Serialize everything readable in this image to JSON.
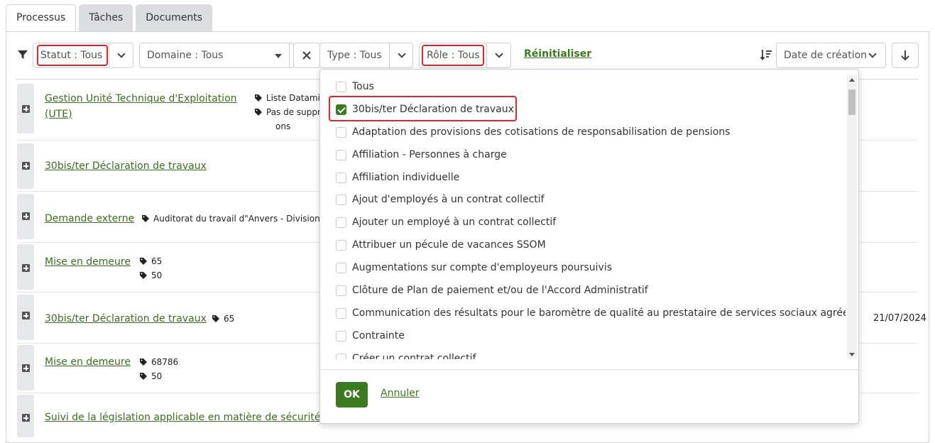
{
  "tabs": [
    {
      "label": "Processus"
    },
    {
      "label": "Tâches"
    },
    {
      "label": "Documents"
    }
  ],
  "filters": {
    "statut": "Statut : Tous",
    "domaine": "Domaine : Tous",
    "type": "Type : Tous",
    "role": "Rôle : Tous",
    "reset": "Réinitialiser",
    "sort": "Date de création"
  },
  "rows": [
    {
      "title_l1": "Gestion Unité Technique d'Exploitation",
      "title_l2": "(UTE)",
      "tag1": "Liste Datamin",
      "tag2": "Pas de suppr",
      "tag2b": "ons"
    },
    {
      "title": "30bis/ter Déclaration de travaux"
    },
    {
      "title": "Demande externe",
      "tag1": "Auditorat du travail d\"Anvers - Division"
    },
    {
      "title": "Mise en demeure",
      "tag1": "65",
      "tag2": "50"
    },
    {
      "title": "30bis/ter Déclaration de travaux",
      "tag1": "65",
      "date": "21/07/2024"
    },
    {
      "title": "Mise en demeure",
      "tag1": "68786",
      "tag2": "50"
    },
    {
      "title": "Suivi de la législation applicable en matière de sécurité s"
    }
  ],
  "dropdown": {
    "options": [
      {
        "label": "Tous",
        "checked": false
      },
      {
        "label": "30bis/ter Déclaration de travaux",
        "checked": true
      },
      {
        "label": "Adaptation des provisions des cotisations de responsabilisation de pensions",
        "checked": false
      },
      {
        "label": "Affiliation - Personnes à charge",
        "checked": false
      },
      {
        "label": "Affiliation individuelle",
        "checked": false
      },
      {
        "label": "Ajout d'employés à un contrat collectif",
        "checked": false
      },
      {
        "label": "Ajouter un employé à un contrat collectif",
        "checked": false
      },
      {
        "label": "Attribuer un pécule de vacances SSOM",
        "checked": false
      },
      {
        "label": "Augmentations sur compte d'employeurs poursuivis",
        "checked": false
      },
      {
        "label": "Clôture de Plan de paiement et/ou de l'Accord Administratif",
        "checked": false
      },
      {
        "label": "Communication des résultats pour le baromètre de qualité au prestataire de services sociaux agréé",
        "checked": false
      },
      {
        "label": "Contrainte",
        "checked": false
      },
      {
        "label": "Créer un contrat collectif",
        "checked": false
      }
    ],
    "ok": "OK",
    "cancel": "Annuler"
  },
  "colors": {
    "accent": "#3b7a1f",
    "highlight": "#e0242a"
  }
}
